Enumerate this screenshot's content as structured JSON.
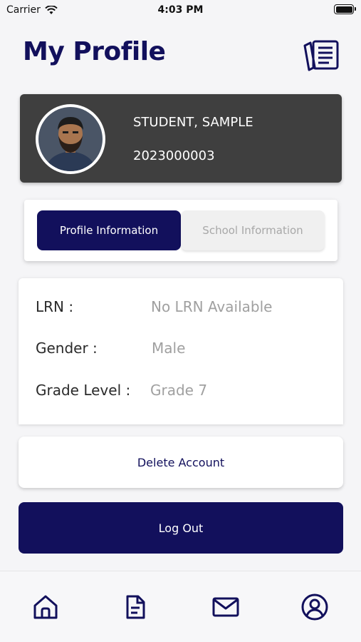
{
  "status_bar": {
    "carrier": "Carrier",
    "time": "4:03 PM"
  },
  "header": {
    "title": "My Profile",
    "notes_icon": "notes-icon"
  },
  "profile": {
    "name": "STUDENT, SAMPLE",
    "id": "2023000003",
    "avatar_icon": "avatar"
  },
  "tabs": [
    {
      "label": "Profile Information",
      "active": true
    },
    {
      "label": "School Information",
      "active": false
    }
  ],
  "info": {
    "lrn_label": "LRN :",
    "lrn_value": "No LRN Available",
    "gender_label": "Gender :",
    "gender_value": "Male",
    "grade_label": "Grade Level :",
    "grade_value": "Grade 7"
  },
  "actions": {
    "delete_label": "Delete Account",
    "logout_label": "Log Out"
  },
  "bottom_nav": [
    {
      "icon": "home-icon"
    },
    {
      "icon": "document-icon"
    },
    {
      "icon": "mail-icon"
    },
    {
      "icon": "user-circle-icon"
    }
  ],
  "colors": {
    "primary": "#12105c",
    "card_dark": "#3f3f3f",
    "muted_text": "#a0a0a0"
  }
}
